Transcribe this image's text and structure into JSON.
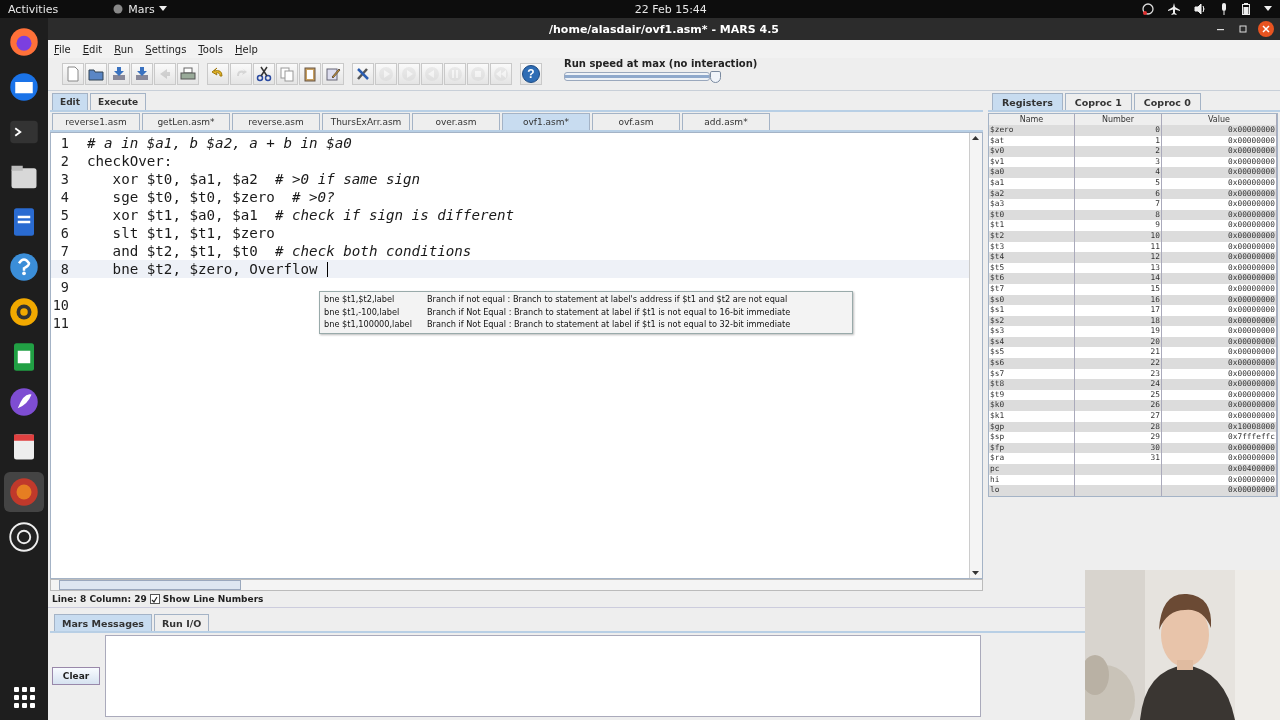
{
  "top_bar": {
    "activities": "Activities",
    "app_menu": "Mars",
    "clock": "22 Feb  15:44"
  },
  "dock": [
    {
      "selected": false
    },
    {
      "selected": false
    },
    {
      "selected": false
    },
    {
      "selected": false
    },
    {
      "selected": false
    },
    {
      "selected": false
    },
    {
      "selected": false
    },
    {
      "selected": false
    },
    {
      "selected": false
    },
    {
      "selected": false
    },
    {
      "selected": true
    },
    {
      "selected": false
    }
  ],
  "window": {
    "title": "/home/alasdair/ovf1.asm* - MARS 4.5"
  },
  "menu": [
    "File",
    "Edit",
    "Run",
    "Settings",
    "Tools",
    "Help"
  ],
  "toolbar": [
    [
      {
        "disabled": false
      },
      {
        "disabled": false
      },
      {
        "disabled": false
      },
      {
        "disabled": false
      },
      {
        "disabled": true
      },
      {
        "disabled": false
      }
    ],
    [
      {
        "disabled": false
      },
      {
        "disabled": true
      },
      {
        "disabled": false
      },
      {
        "disabled": false
      },
      {
        "disabled": false
      },
      {
        "disabled": false
      }
    ],
    [
      {
        "disabled": false
      },
      {
        "disabled": true
      },
      {
        "disabled": true
      },
      {
        "disabled": true
      },
      {
        "disabled": true
      },
      {
        "disabled": true
      },
      {
        "disabled": true
      }
    ],
    [
      {
        "disabled": false,
        "glyph": "?"
      }
    ]
  ],
  "run_speed": {
    "label": "Run speed at max (no interaction)",
    "level": 1
  },
  "editor": {
    "mode_tabs": [
      {
        "label": "Edit",
        "selected": true
      },
      {
        "label": "Execute",
        "selected": false
      }
    ],
    "files": [
      {
        "label": "reverse1.asm",
        "selected": false
      },
      {
        "label": "getLen.asm*",
        "selected": false
      },
      {
        "label": "reverse.asm",
        "selected": false
      },
      {
        "label": "ThursExArr.asm",
        "selected": false
      },
      {
        "label": "over.asm",
        "selected": false
      },
      {
        "label": "ovf1.asm*",
        "selected": true
      },
      {
        "label": "ovf.asm",
        "selected": false
      },
      {
        "label": "add.asm*",
        "selected": false
      }
    ],
    "lines": [
      {
        "number": "1",
        "kind": "comment",
        "text": "# a in $a1, b $a2, a + b in $a0",
        "current": false
      },
      {
        "number": "2",
        "kind": "code",
        "text": "checkOver:",
        "current": false
      },
      {
        "number": "3",
        "kind": "code",
        "text": "   xor $t0, $a1, $a2  *# >0 if same sign*",
        "current": false
      },
      {
        "number": "4",
        "kind": "code",
        "text": "   sge $t0, $t0, $zero  *# >0?*",
        "current": false
      },
      {
        "number": "5",
        "kind": "code",
        "text": "   xor $t1, $a0, $a1  *# check if sign is different*",
        "current": false
      },
      {
        "number": "6",
        "kind": "code",
        "text": "   slt $t1, $t1, $zero",
        "current": false
      },
      {
        "number": "7",
        "kind": "code",
        "text": "   and $t2, $t1, $t0  *# check both conditions*",
        "current": false
      },
      {
        "number": "8",
        "kind": "code",
        "text": "   bne $t2, $zero, Overflow",
        "current": true
      },
      {
        "number": "9",
        "kind": "blank",
        "current": false
      },
      {
        "number": "10",
        "kind": "blank",
        "current": false
      },
      {
        "number": "11",
        "kind": "blank",
        "current": false
      }
    ],
    "autocomplete": [
      {
        "syntax": "bne $t1,$t2,label",
        "description": "Branch if not equal : Branch to statement at label's address if $t1 and $t2 are not equal"
      },
      {
        "syntax": "bne $t1,-100,label",
        "description": "Branch if Not Equal : Branch to statement at label if $t1 is not equal to 16-bit immediate"
      },
      {
        "syntax": "bne $t1,100000,label",
        "description": "Branch if Not Equal : Branch to statement at label if $t1 is not equal to 32-bit immediate"
      }
    ],
    "status": "Line: 8 Column: 29",
    "show_line_numbers": {
      "label": "Show Line Numbers",
      "checked": true
    }
  },
  "registers": {
    "tabs": [
      {
        "label": "Registers",
        "selected": true
      },
      {
        "label": "Coproc 1",
        "selected": false
      },
      {
        "label": "Coproc 0",
        "selected": false
      }
    ],
    "columns": [
      "Name",
      "Number",
      "Value"
    ],
    "rows": [
      {
        "name": "$zero",
        "number": "0",
        "value": "0x00000000"
      },
      {
        "name": "$at",
        "number": "1",
        "value": "0x00000000"
      },
      {
        "name": "$v0",
        "number": "2",
        "value": "0x00000000"
      },
      {
        "name": "$v1",
        "number": "3",
        "value": "0x00000000"
      },
      {
        "name": "$a0",
        "number": "4",
        "value": "0x00000000"
      },
      {
        "name": "$a1",
        "number": "5",
        "value": "0x00000000"
      },
      {
        "name": "$a2",
        "number": "6",
        "value": "0x00000000"
      },
      {
        "name": "$a3",
        "number": "7",
        "value": "0x00000000"
      },
      {
        "name": "$t0",
        "number": "8",
        "value": "0x00000000"
      },
      {
        "name": "$t1",
        "number": "9",
        "value": "0x00000000"
      },
      {
        "name": "$t2",
        "number": "10",
        "value": "0x00000000"
      },
      {
        "name": "$t3",
        "number": "11",
        "value": "0x00000000"
      },
      {
        "name": "$t4",
        "number": "12",
        "value": "0x00000000"
      },
      {
        "name": "$t5",
        "number": "13",
        "value": "0x00000000"
      },
      {
        "name": "$t6",
        "number": "14",
        "value": "0x00000000"
      },
      {
        "name": "$t7",
        "number": "15",
        "value": "0x00000000"
      },
      {
        "name": "$s0",
        "number": "16",
        "value": "0x00000000"
      },
      {
        "name": "$s1",
        "number": "17",
        "value": "0x00000000"
      },
      {
        "name": "$s2",
        "number": "18",
        "value": "0x00000000"
      },
      {
        "name": "$s3",
        "number": "19",
        "value": "0x00000000"
      },
      {
        "name": "$s4",
        "number": "20",
        "value": "0x00000000"
      },
      {
        "name": "$s5",
        "number": "21",
        "value": "0x00000000"
      },
      {
        "name": "$s6",
        "number": "22",
        "value": "0x00000000"
      },
      {
        "name": "$s7",
        "number": "23",
        "value": "0x00000000"
      },
      {
        "name": "$t8",
        "number": "24",
        "value": "0x00000000"
      },
      {
        "name": "$t9",
        "number": "25",
        "value": "0x00000000"
      },
      {
        "name": "$k0",
        "number": "26",
        "value": "0x00000000"
      },
      {
        "name": "$k1",
        "number": "27",
        "value": "0x00000000"
      },
      {
        "name": "$gp",
        "number": "28",
        "value": "0x10008000"
      },
      {
        "name": "$sp",
        "number": "29",
        "value": "0x7fffeffc"
      },
      {
        "name": "$fp",
        "number": "30",
        "value": "0x00000000"
      },
      {
        "name": "$ra",
        "number": "31",
        "value": "0x00000000"
      },
      {
        "name": "pc",
        "value": "0x00400000"
      },
      {
        "name": "hi",
        "value": "0x00000000"
      },
      {
        "name": "lo",
        "value": "0x00000000"
      }
    ]
  },
  "messages": {
    "tabs": [
      {
        "label": "Mars Messages",
        "selected": true
      },
      {
        "label": "Run I/O",
        "selected": false
      }
    ],
    "clear_button": "Clear"
  },
  "webcam": {
    "kind": "picture"
  }
}
